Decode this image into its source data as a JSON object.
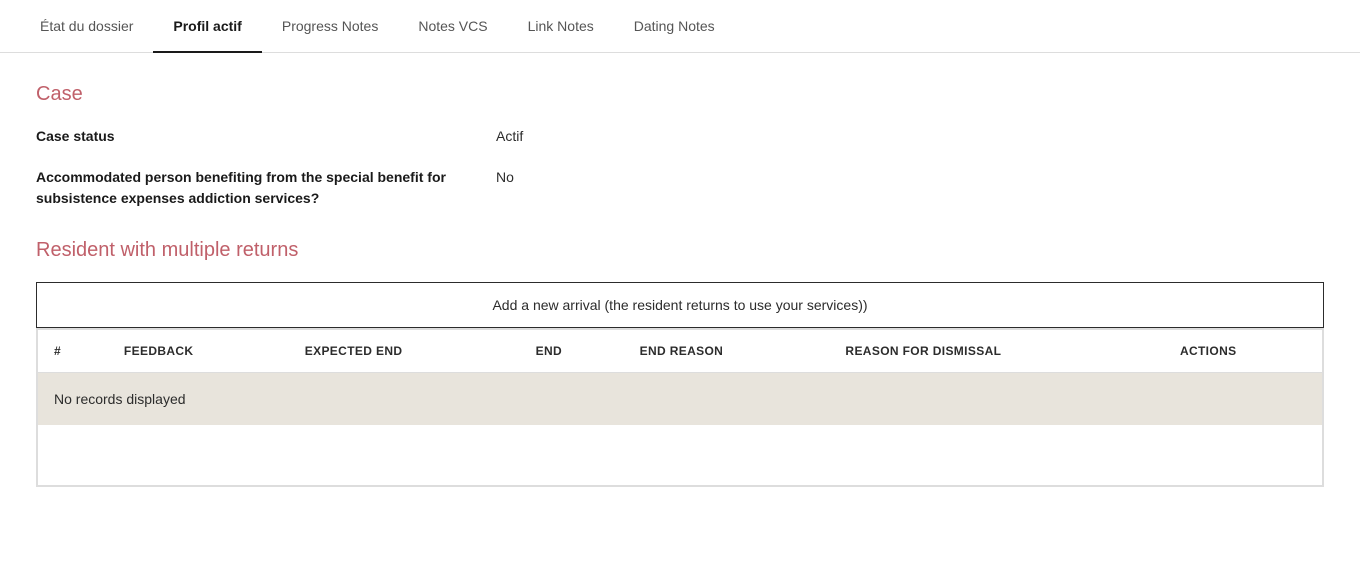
{
  "tabs": [
    {
      "id": "etat",
      "label": "État du dossier",
      "active": false
    },
    {
      "id": "profil",
      "label": "Profil actif",
      "active": true
    },
    {
      "id": "progress",
      "label": "Progress Notes",
      "active": false
    },
    {
      "id": "notes-vcs",
      "label": "Notes VCS",
      "active": false
    },
    {
      "id": "link-notes",
      "label": "Link Notes",
      "active": false
    },
    {
      "id": "dating-notes",
      "label": "Dating Notes",
      "active": false
    }
  ],
  "case_section": {
    "heading": "Case",
    "fields": [
      {
        "label": "Case status",
        "value": "Actif"
      },
      {
        "label": "Accommodated person benefiting from the special benefit for subsistence expenses addiction services?",
        "value": "No"
      }
    ]
  },
  "resident_section": {
    "heading": "Resident with multiple returns",
    "add_button_label": "Add a new arrival (the resident returns to use your services))",
    "table": {
      "columns": [
        {
          "key": "num",
          "label": "#"
        },
        {
          "key": "feedback",
          "label": "FEEDBACK"
        },
        {
          "key": "expected_end",
          "label": "EXPECTED END"
        },
        {
          "key": "end",
          "label": "END"
        },
        {
          "key": "end_reason",
          "label": "END REASON"
        },
        {
          "key": "dismissal",
          "label": "REASON FOR DISMISSAL"
        },
        {
          "key": "actions",
          "label": "ACTIONS"
        }
      ],
      "no_records_text": "No records displayed",
      "rows": []
    }
  }
}
